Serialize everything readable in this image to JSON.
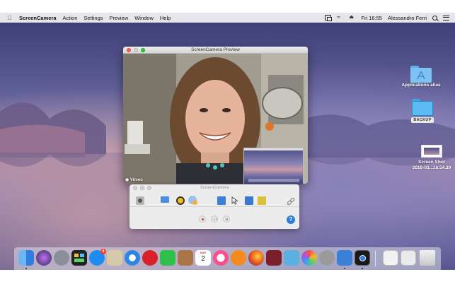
{
  "menubar": {
    "app_name": "ScreenCamera",
    "menus": [
      "Action",
      "Settings",
      "Preview",
      "Window",
      "Help"
    ],
    "clock": "Fri 16:55",
    "user": "Alessandro Ferri",
    "icons": [
      "apple-icon",
      "screen-mirroring-icon",
      "wifi-icon",
      "eject-icon",
      "spotlight-search-icon",
      "notification-center-icon"
    ]
  },
  "desktop": {
    "items": [
      {
        "label": "Applications alias",
        "icon": "applications-folder-icon"
      },
      {
        "label": "BACKUP",
        "icon": "backup-drive-icon"
      },
      {
        "label_line1": "Screen Shot",
        "label_line2": "2018-03...16.54.39",
        "icon": "screenshot-file-icon"
      }
    ]
  },
  "preview_window": {
    "title": "ScreenCamera Preview",
    "watermark": "Vimeo"
  },
  "control_panel": {
    "title": "ScreenCamera",
    "tools": [
      "camera-icon",
      "screen-icon",
      "webcam-icon",
      "effects-icon",
      "region-icon",
      "cursor-icon",
      "display-icon",
      "book-icon",
      "link-icon"
    ],
    "help_label": "?"
  },
  "dock": {
    "calendar_month": "MAR",
    "calendar_day": "2",
    "app_store_badge": "4"
  },
  "colors": {
    "accent_blue": "#2e7de0",
    "close_red": "#fc5f57",
    "minimize_yellow": "#fdbb2e",
    "zoom_green": "#2bc840"
  }
}
